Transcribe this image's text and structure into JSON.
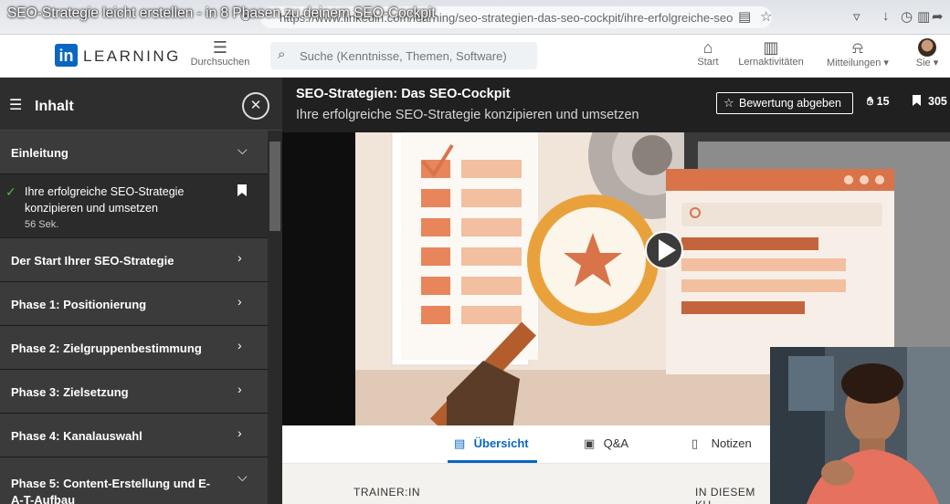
{
  "browser": {
    "url": "https://www.linkedin.com/learning/seo-strategien-das-seo-cockpit/ihre-erfolgreiche-seo",
    "youtube_title": "SEO-Strategie leicht erstellen - in 8 Phasen zu deinem SEO-Cockpit"
  },
  "header": {
    "logo_in": "in",
    "logo_word": "LEARNING",
    "browse_label": "Durchsuchen",
    "search_placeholder": "Suche (Kenntnisse, Themen, Software)",
    "nav": {
      "home": "Start",
      "activities": "Lernaktivitäten",
      "notifications": "Mitteilungen",
      "me": "Sie"
    }
  },
  "sidebar": {
    "title": "Inhalt",
    "sections": [
      {
        "label": "Einleitung",
        "expanded": true
      },
      {
        "label": "Der Start Ihrer SEO-Strategie",
        "expanded": false
      },
      {
        "label": "Phase 1: Positionierung",
        "expanded": false
      },
      {
        "label": "Phase 2: Zielgruppenbestimmung",
        "expanded": false
      },
      {
        "label": "Phase 3: Zielsetzung",
        "expanded": false
      },
      {
        "label": "Phase 4: Kanalauswahl",
        "expanded": false
      },
      {
        "label": "Phase 5: Content-Erstellung und E-A-T-Aufbau",
        "expanded": true
      }
    ],
    "lesson": {
      "title": "Ihre erfolgreiche SEO-Strategie konzipieren und umsetzen",
      "duration": "56 Sek."
    }
  },
  "video": {
    "course_title": "SEO-Strategien: Das SEO-Cockpit",
    "lesson_title": "Ihre erfolgreiche SEO-Strategie konzipieren und umsetzen",
    "rate_label": "Bewertung abgeben",
    "likes": "15",
    "saves": "305"
  },
  "tabs": [
    {
      "label": "Übersicht",
      "active": true
    },
    {
      "label": "Q&A",
      "active": false
    },
    {
      "label": "Notizen",
      "active": false
    }
  ],
  "details": {
    "trainer_heading": "TRAINER:IN",
    "course_heading": "IN DIESEM KU"
  },
  "colors": {
    "brand": "#0a66c2",
    "sidebar_bg": "#2e2e2e",
    "check": "#57b65b",
    "accent_orange": "#d9744a"
  }
}
